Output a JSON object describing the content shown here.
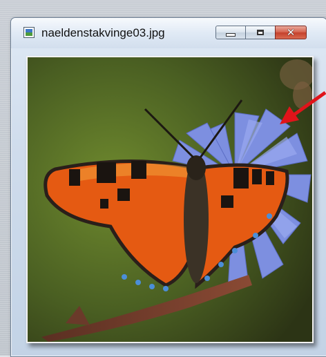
{
  "window": {
    "title": "naeldenstakvinge03.jpg",
    "icon": "image-file-icon",
    "controls": {
      "minimize_icon": "minimize-icon",
      "maximize_icon": "maximize-icon",
      "close_icon": "close-icon",
      "close_glyph": "✕"
    }
  },
  "image": {
    "subject_icon": "butterfly-on-blue-flower",
    "annotation_icon": "red-arrow-icon"
  },
  "colors": {
    "close_button": "#c4402b",
    "arrow": "#e0141a"
  }
}
